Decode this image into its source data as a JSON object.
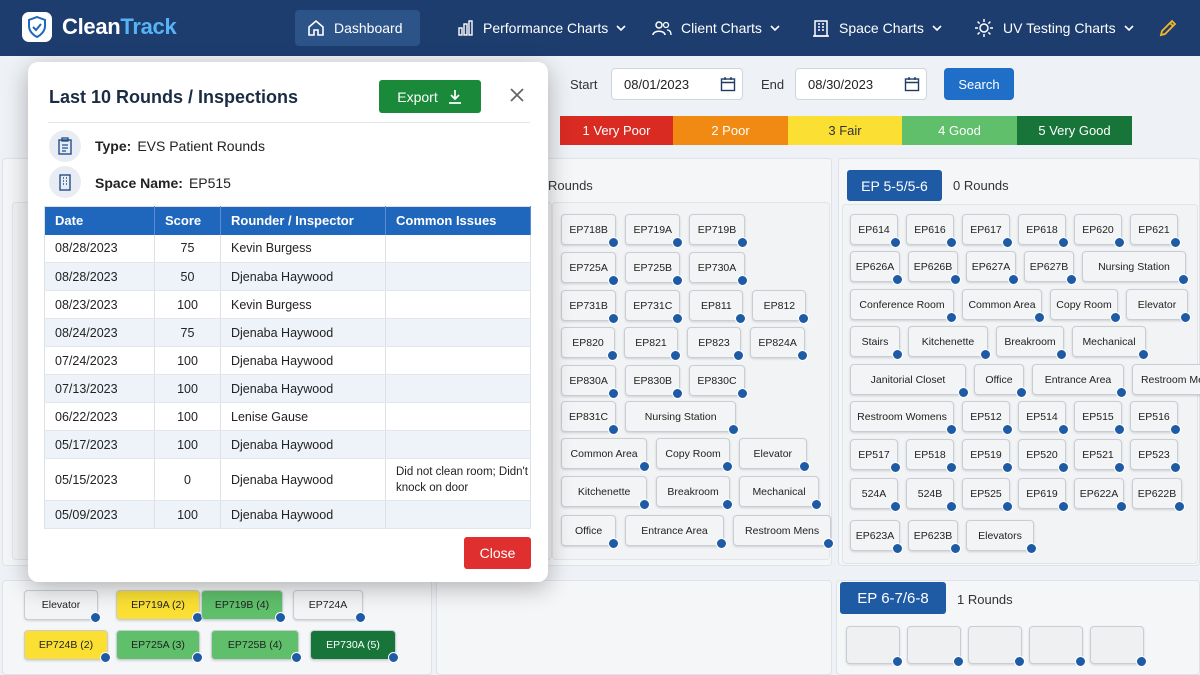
{
  "app": {
    "logo_part1": "Clean",
    "logo_part2": "Track"
  },
  "nav": {
    "dashboard": "Dashboard",
    "performance": "Performance Charts",
    "client": "Client Charts",
    "space": "Space Charts",
    "uv": "UV Testing Charts"
  },
  "filters": {
    "start_label": "Start",
    "start_value": "08/01/2023",
    "end_label": "End",
    "end_value": "08/30/2023",
    "search_label": "Search"
  },
  "legend": [
    {
      "label": "1 Very Poor",
      "color": "#d92b22",
      "text": "#ffffff"
    },
    {
      "label": "2 Poor",
      "color": "#f08a12",
      "text": "#ffffff"
    },
    {
      "label": "3 Fair",
      "color": "#fbe033",
      "text": "#333333"
    },
    {
      "label": "4 Good",
      "color": "#5fbf6b",
      "text": "#ffffff"
    },
    {
      "label": "5 Very Good",
      "color": "#18753a",
      "text": "#ffffff"
    }
  ],
  "middle_panel": {
    "rounds": "Rounds"
  },
  "ep55": {
    "tag": "EP 5-5/5-6",
    "rounds": "0 Rounds"
  },
  "ep67": {
    "tag": "EP 6-7/6-8",
    "rounds": "1 Rounds"
  },
  "modal": {
    "title": "Last 10 Rounds / Inspections",
    "export": "Export",
    "type_label": "Type:",
    "type_value": "EVS Patient Rounds",
    "space_label": "Space Name:",
    "space_value": "EP515",
    "close": "Close",
    "columns": [
      "Date",
      "Score",
      "Rounder / Inspector",
      "Common Issues"
    ],
    "rows": [
      {
        "date": "08/28/2023",
        "score": "75",
        "inspector": "Kevin Burgess",
        "issues": ""
      },
      {
        "date": "08/28/2023",
        "score": "50",
        "inspector": "Djenaba Haywood",
        "issues": ""
      },
      {
        "date": "08/23/2023",
        "score": "100",
        "inspector": "Kevin Burgess",
        "issues": ""
      },
      {
        "date": "08/24/2023",
        "score": "75",
        "inspector": "Djenaba Haywood",
        "issues": ""
      },
      {
        "date": "07/24/2023",
        "score": "100",
        "inspector": "Djenaba Haywood",
        "issues": ""
      },
      {
        "date": "07/13/2023",
        "score": "100",
        "inspector": "Djenaba Haywood",
        "issues": ""
      },
      {
        "date": "06/22/2023",
        "score": "100",
        "inspector": "Lenise Gause",
        "issues": ""
      },
      {
        "date": "05/17/2023",
        "score": "100",
        "inspector": "Djenaba Haywood",
        "issues": ""
      },
      {
        "date": "05/15/2023",
        "score": "0",
        "inspector": "Djenaba Haywood",
        "issues": "Did not clean room; Didn't knock on door"
      },
      {
        "date": "05/09/2023",
        "score": "100",
        "inspector": "Djenaba Haywood",
        "issues": ""
      }
    ]
  },
  "mid_rooms": [
    "EP718B",
    "EP719A",
    "EP719B",
    "EP725A",
    "EP725B",
    "EP730A",
    "EP731B",
    "EP731C",
    "EP811",
    "EP812",
    "EP820",
    "EP821",
    "EP823",
    "EP824A",
    "EP830A",
    "EP830B",
    "EP830C",
    "EP831C",
    "Nursing Station",
    "Common Area",
    "Copy Room",
    "Elevator",
    "Kitchenette",
    "Breakroom",
    "Mechanical",
    "Office",
    "Entrance Area",
    "Restroom Mens"
  ],
  "ep55_rooms": [
    "EP614",
    "EP616",
    "EP617",
    "EP618",
    "EP620",
    "EP621",
    "EP626A",
    "EP626B",
    "EP627A",
    "EP627B",
    "Nursing Station",
    "Conference Room",
    "Common Area",
    "Copy Room",
    "Elevator",
    "Stairs",
    "Kitchenette",
    "Breakroom",
    "Mechanical",
    "Janitorial Closet",
    "Office",
    "Entrance Area",
    "Restroom Mens",
    "Restroom Womens",
    "EP512",
    "EP514",
    "EP515",
    "EP516",
    "EP517",
    "EP518",
    "EP519",
    "EP520",
    "EP521",
    "EP523",
    "524A",
    "524B",
    "EP525",
    "EP619",
    "EP622A",
    "EP622B",
    "EP623A",
    "EP623B",
    "Elevators"
  ],
  "bottom_rooms": [
    {
      "label": "Elevator",
      "color": "#f3f4f6"
    },
    {
      "label": "EP719A (2)",
      "color": "#fbe033"
    },
    {
      "label": "EP719B (4)",
      "color": "#5fbf6b"
    },
    {
      "label": "EP724A",
      "color": "#f3f4f6"
    },
    {
      "label": "EP724B (2)",
      "color": "#fbe033"
    },
    {
      "label": "EP725A (3)",
      "color": "#5fbf6b"
    },
    {
      "label": "EP725B (4)",
      "color": "#5fbf6b"
    },
    {
      "label": "EP730A (5)",
      "color": "#18753a"
    }
  ]
}
